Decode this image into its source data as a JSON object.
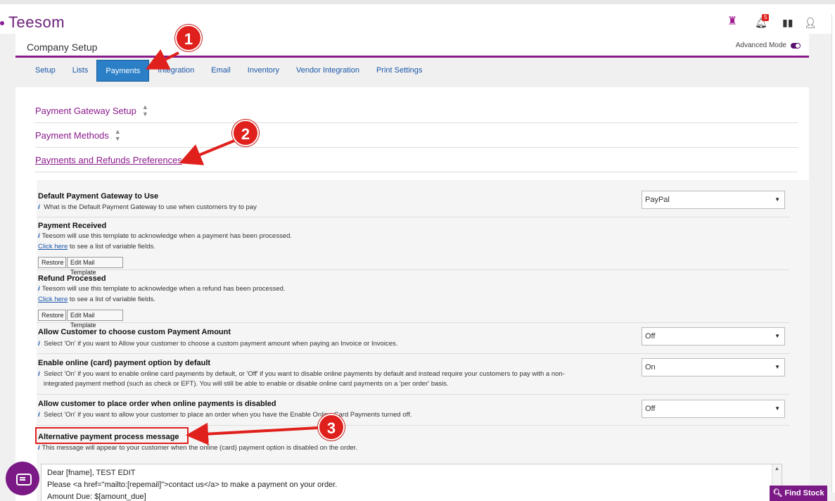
{
  "app": {
    "logo_text": "Teesom",
    "notification_count": "5"
  },
  "header": {
    "title": "Company Setup",
    "advanced_mode_label": "Advanced Mode"
  },
  "tabs": [
    {
      "label": "Setup"
    },
    {
      "label": "Lists"
    },
    {
      "label": "Payments",
      "active": true
    },
    {
      "label": "Integration"
    },
    {
      "label": "Email"
    },
    {
      "label": "Inventory"
    },
    {
      "label": "Vendor Integration"
    },
    {
      "label": "Print Settings"
    }
  ],
  "accordion": [
    {
      "label": "Payment Gateway Setup"
    },
    {
      "label": "Payment Methods"
    },
    {
      "label": "Payments and Refunds Preferences"
    }
  ],
  "settings": {
    "default_gateway": {
      "label": "Default Payment Gateway to Use",
      "help": "What is the Default Payment Gateway to use when customers try to pay",
      "value": "PayPal"
    },
    "payment_received": {
      "label": "Payment Received",
      "help": "Teesom will use this template to acknowledge when a payment has been processed.",
      "link": "Click here",
      "link_suffix": " to see a list of variable fields.",
      "restore": "Restore",
      "edit": "Edit Mail Template"
    },
    "refund_processed": {
      "label": "Refund Processed",
      "help": "Teesom will use this template to acknowledge when a refund has been processed.",
      "link": "Click here",
      "link_suffix": " to see a list of variable fields.",
      "restore": "Restore",
      "edit": "Edit Mail Template"
    },
    "custom_amount": {
      "label": "Allow Customer to choose custom Payment Amount",
      "help": "Select 'On' if you want to Allow your customer to choose a custom payment amount when paying an Invoice or Invoices.",
      "value": "Off"
    },
    "online_card": {
      "label": "Enable online (card) payment option by default",
      "help1": "Select 'On' if you want to enable online card payments by default, or 'Off' if you want to disable online payments by default and instead require your customers to pay with a non-",
      "help2": "integrated payment method (such as check or EFT). You will still be able to enable or disable online card payments on a 'per order' basis.",
      "value": "On"
    },
    "order_when_disabled": {
      "label": "Allow customer to place order when online payments is disabled",
      "help": "Select 'On' if you want to allow your customer to place an order when you have the Enable Online Card Payments turned off.",
      "value": "Off"
    },
    "alt_message": {
      "label": "Alternative payment process message",
      "help": "This message will appear to your customer when the online (card) payment option is disabled on the order.",
      "lines": [
        "Dear [fname], TEST EDIT",
        "Please <a href=\"mailto:[repemail]\">contact us</a> to make a payment on your order.",
        "Amount Due: $[amount_due]"
      ]
    }
  },
  "callouts": [
    "1",
    "2",
    "3"
  ],
  "find_stock_label": "Find Stock",
  "colors": {
    "brand": "#7b1a86",
    "accent": "#8b1a8b",
    "tab_active": "#2a7fc6",
    "callout": "#e0201c"
  }
}
